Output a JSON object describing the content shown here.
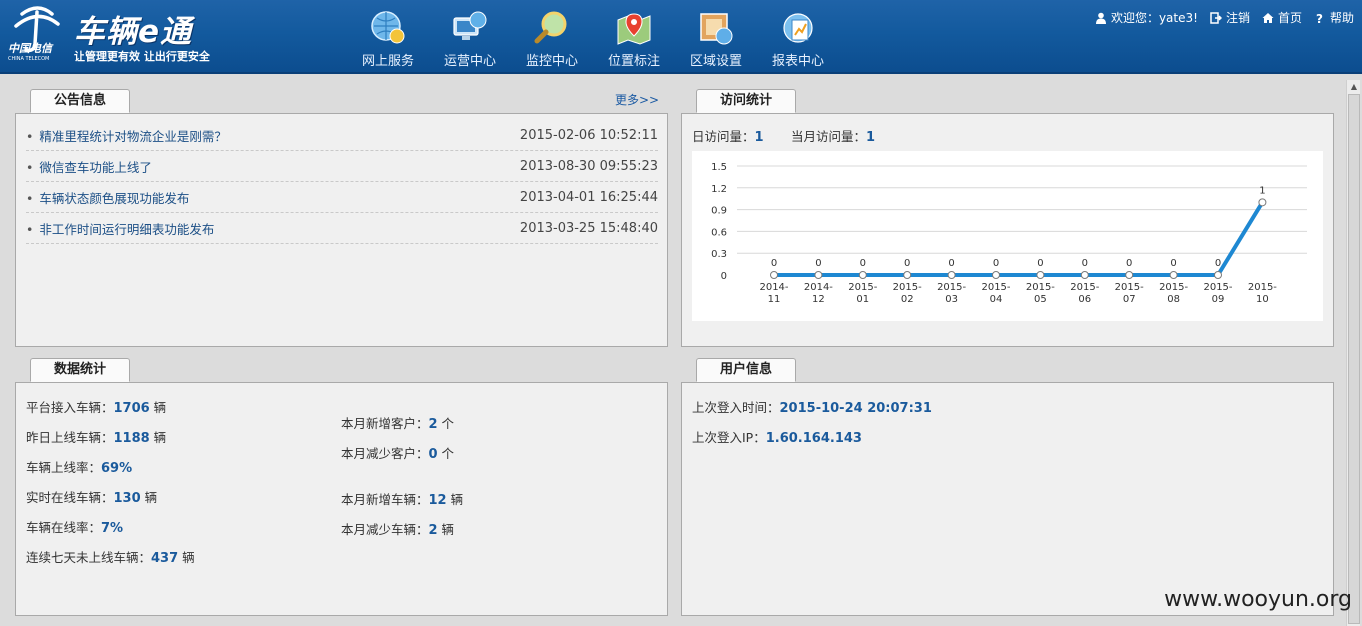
{
  "header": {
    "logo_brand": "中国电信",
    "logo_brand_en": "CHINA TELECOM",
    "app_title": "车辆e通",
    "slogan": "让管理更有效  让出行更安全",
    "nav": [
      {
        "label": "网上服务",
        "icon": "globe-chat-icon"
      },
      {
        "label": "运营中心",
        "icon": "monitor-globe-icon"
      },
      {
        "label": "监控中心",
        "icon": "magnifier-icon"
      },
      {
        "label": "位置标注",
        "icon": "map-pin-icon"
      },
      {
        "label": "区域设置",
        "icon": "area-map-icon"
      },
      {
        "label": "报表中心",
        "icon": "report-icon"
      }
    ],
    "welcome": "欢迎您：yate3!",
    "logout": "注销",
    "home": "首页",
    "help": "帮助"
  },
  "notice": {
    "tab": "公告信息",
    "more": "更多>>",
    "items": [
      {
        "title": "精准里程统计对物流企业是刚需？",
        "date": "2015-02-06 10:52:11"
      },
      {
        "title": "微信查车功能上线了",
        "date": "2013-08-30 09:55:23"
      },
      {
        "title": "车辆状态颜色展现功能发布",
        "date": "2013-04-01 16:25:44"
      },
      {
        "title": "非工作时间运行明细表功能发布",
        "date": "2013-03-25 15:48:40"
      }
    ]
  },
  "visits": {
    "tab": "访问统计",
    "daily_label": "日访问量：",
    "daily_value": "1",
    "monthly_label": "当月访问量：",
    "monthly_value": "1"
  },
  "chart_data": {
    "type": "line",
    "categories": [
      "2014-11",
      "2014-12",
      "2015-01",
      "2015-02",
      "2015-03",
      "2015-04",
      "2015-05",
      "2015-06",
      "2015-07",
      "2015-08",
      "2015-09",
      "2015-10"
    ],
    "series": [
      {
        "values": [
          0,
          0,
          0,
          0,
          0,
          0,
          0,
          0,
          0,
          0,
          0,
          1
        ]
      }
    ],
    "y_ticks": [
      "0",
      "0.3",
      "0.6",
      "0.9",
      "1.2",
      "1.5"
    ],
    "ylim": [
      0,
      1.5
    ],
    "color": "#1e88d2",
    "grid": true,
    "data_labels": true,
    "title": "",
    "xlabel": "",
    "ylabel": ""
  },
  "stats": {
    "tab": "数据统计",
    "left": [
      {
        "label": "平台接入车辆：",
        "value": "1706",
        "unit": " 辆"
      },
      {
        "label": "昨日上线车辆：",
        "value": "1188",
        "unit": " 辆"
      },
      {
        "label": "车辆上线率：",
        "value": "69%",
        "unit": ""
      },
      {
        "label": "实时在线车辆：",
        "value": "130",
        "unit": " 辆"
      },
      {
        "label": "车辆在线率：",
        "value": "7%",
        "unit": ""
      },
      {
        "label": "连续七天未上线车辆：",
        "value": "437",
        "unit": " 辆"
      }
    ],
    "right": [
      {
        "label": "本月新增客户：",
        "value": "2",
        "unit": " 个"
      },
      {
        "label": "本月减少客户：",
        "value": "0",
        "unit": " 个"
      },
      {
        "label": "本月新增车辆：",
        "value": "12",
        "unit": " 辆"
      },
      {
        "label": "本月减少车辆：",
        "value": "2",
        "unit": " 辆"
      }
    ]
  },
  "user": {
    "tab": "用户信息",
    "last_login_time_label": "上次登入时间：",
    "last_login_time": "2015-10-24 20:07:31",
    "last_login_ip_label": "上次登入IP：",
    "last_login_ip": "1.60.164.143"
  },
  "watermark": "www.wooyun.org"
}
